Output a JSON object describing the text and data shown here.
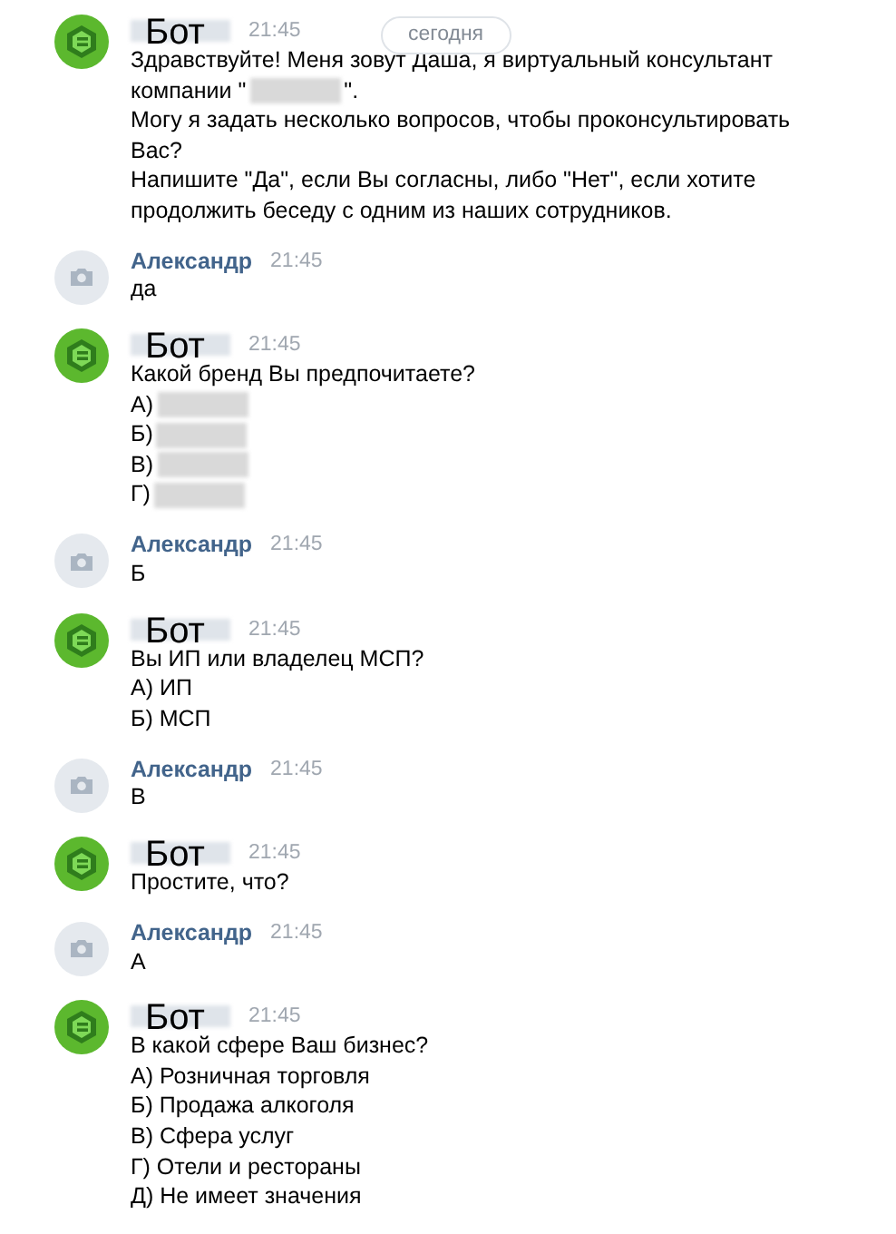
{
  "date_pill": "сегодня",
  "messages": [
    {
      "kind": "bot",
      "author": "Бот",
      "name_redacted": true,
      "time": "21:45",
      "lines": [
        [
          {
            "kind": "text",
            "text": "Здравствуйте! Меня зовут Даша, я виртуальный консультант"
          }
        ],
        [
          {
            "kind": "text",
            "text": "компании \""
          },
          {
            "kind": "redaction"
          },
          {
            "kind": "text",
            "text": "\"."
          }
        ],
        [
          {
            "kind": "text",
            "text": "Могу я задать несколько вопросов, чтобы проконсультировать"
          }
        ],
        [
          {
            "kind": "text",
            "text": "Вас?"
          }
        ],
        [
          {
            "kind": "text",
            "text": "Напишите \"Да\", если Вы согласны, либо \"Нет\", если хотите"
          }
        ],
        [
          {
            "kind": "text",
            "text": "продолжить беседу с одним из наших сотрудников."
          }
        ]
      ]
    },
    {
      "kind": "user",
      "author": "Александр",
      "name_redacted": false,
      "time": "21:45",
      "lines": [
        [
          {
            "kind": "text",
            "text": "да"
          }
        ]
      ]
    },
    {
      "kind": "bot",
      "author": "Бот",
      "name_redacted": true,
      "time": "21:45",
      "lines": [
        [
          {
            "kind": "text",
            "text": "Какой бренд Вы предпочитаете?"
          }
        ],
        [
          {
            "kind": "text",
            "text": "А)"
          },
          {
            "kind": "redaction"
          }
        ],
        [
          {
            "kind": "text",
            "text": "Б)"
          },
          {
            "kind": "redaction"
          }
        ],
        [
          {
            "kind": "text",
            "text": "В)"
          },
          {
            "kind": "redaction"
          }
        ],
        [
          {
            "kind": "text",
            "text": "Г)"
          },
          {
            "kind": "redaction"
          }
        ]
      ]
    },
    {
      "kind": "user",
      "author": "Александр",
      "name_redacted": false,
      "time": "21:45",
      "lines": [
        [
          {
            "kind": "text",
            "text": "Б"
          }
        ]
      ]
    },
    {
      "kind": "bot",
      "author": "Бот",
      "name_redacted": true,
      "time": "21:45",
      "lines": [
        [
          {
            "kind": "text",
            "text": "Вы ИП или владелец МСП?"
          }
        ],
        [
          {
            "kind": "text",
            "text": "А) ИП"
          }
        ],
        [
          {
            "kind": "text",
            "text": "Б) МСП"
          }
        ]
      ]
    },
    {
      "kind": "user",
      "author": "Александр",
      "name_redacted": false,
      "time": "21:45",
      "lines": [
        [
          {
            "kind": "text",
            "text": "В"
          }
        ]
      ]
    },
    {
      "kind": "bot",
      "author": "Бот",
      "name_redacted": true,
      "time": "21:45",
      "lines": [
        [
          {
            "kind": "text",
            "text": "Простите, что?"
          }
        ]
      ]
    },
    {
      "kind": "user",
      "author": "Александр",
      "name_redacted": false,
      "time": "21:45",
      "lines": [
        [
          {
            "kind": "text",
            "text": "А"
          }
        ]
      ]
    },
    {
      "kind": "bot",
      "author": "Бот",
      "name_redacted": true,
      "time": "21:45",
      "lines": [
        [
          {
            "kind": "text",
            "text": "В какой сфере Ваш бизнес?"
          }
        ],
        [
          {
            "kind": "text",
            "text": "А) Розничная торговля"
          }
        ],
        [
          {
            "kind": "text",
            "text": "Б) Продажа алкоголя"
          }
        ],
        [
          {
            "kind": "text",
            "text": "В) Сфера услуг"
          }
        ],
        [
          {
            "kind": "text",
            "text": "Г) Отели и рестораны"
          }
        ],
        [
          {
            "kind": "text",
            "text": "Д) Не имеет значения"
          }
        ]
      ]
    }
  ]
}
